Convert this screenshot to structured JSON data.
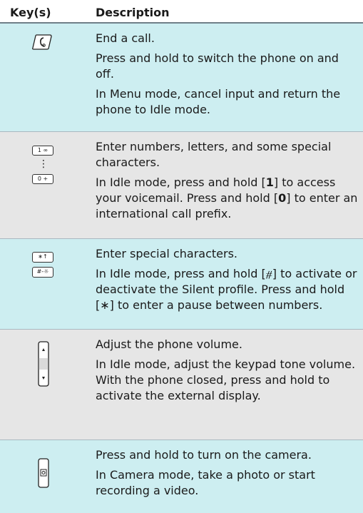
{
  "header": {
    "keys_label": "Key(s)",
    "description_label": "Description"
  },
  "rows": [
    {
      "icon": "end-call-key-icon",
      "lines": [
        "End a call.",
        "Press and hold to switch the phone on and off.",
        "In Menu mode, cancel input and return the phone to Idle mode."
      ]
    },
    {
      "icon": "alphanumeric-keys-icon",
      "key_top": "1 ∞",
      "key_bottom": "0 +",
      "key_dots": "⋮",
      "lines": [
        "Enter numbers, letters, and some special characters."
      ],
      "rich": {
        "a": "In Idle mode, press and hold [",
        "b": "1",
        "c": "] to access your voicemail. Press and hold [",
        "d": "0",
        "e": "] to enter an international call prefix."
      }
    },
    {
      "icon": "special-keys-icon",
      "key_top": "∗↑",
      "key_bottom": "#-☼",
      "lines": [
        "Enter special characters.",
        "In Idle mode, press and hold [⧣] to activate or deactivate the Silent profile. Press and hold [∗] to enter a pause between numbers."
      ]
    },
    {
      "icon": "volume-key-icon",
      "lines": [
        "Adjust the phone volume.",
        "In Idle mode, adjust the keypad tone volume. With the phone closed, press and hold to activate the external display."
      ]
    },
    {
      "icon": "camera-key-icon",
      "lines": [
        "Press and hold to turn on the camera.",
        "In Camera mode, take a photo or start recording a video."
      ]
    }
  ]
}
